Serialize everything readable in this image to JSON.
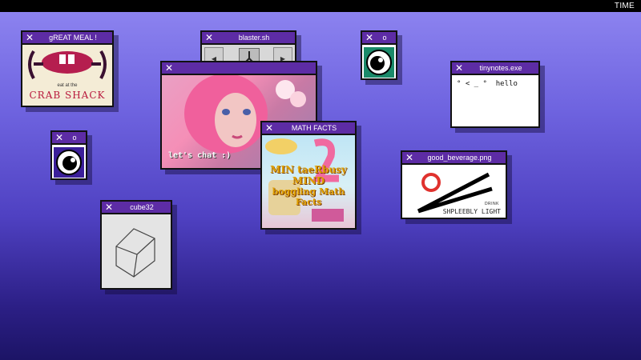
{
  "topbar": {
    "time": "TIME"
  },
  "windows": {
    "meal": {
      "title": "gREAT MEAL !",
      "tagline": "eat at the",
      "brand": "CRAB SHACK"
    },
    "blaster": {
      "title": "blaster.sh"
    },
    "chat": {
      "caption": "let's chat :)"
    },
    "math": {
      "title": "MATH FACTS",
      "headline_1": "MIN taeRbusy MIND",
      "headline_2": "boggling Math Facts"
    },
    "eye_top": {
      "title": "o",
      "bg_color": "#1a8a6a"
    },
    "eye_left": {
      "title": "o",
      "bg_color": "#3b1f9a"
    },
    "notes": {
      "title": "tinynotes.exe",
      "text": "° < _ °  hello"
    },
    "beverage": {
      "title": "good_beverage.png",
      "drink": "DRINK",
      "brand": "SHPLEEBLY LIGHT"
    },
    "cube": {
      "title": "cube32"
    }
  },
  "colors": {
    "titlebar": "#5d2ca5",
    "accent_pink": "#b8183c"
  }
}
